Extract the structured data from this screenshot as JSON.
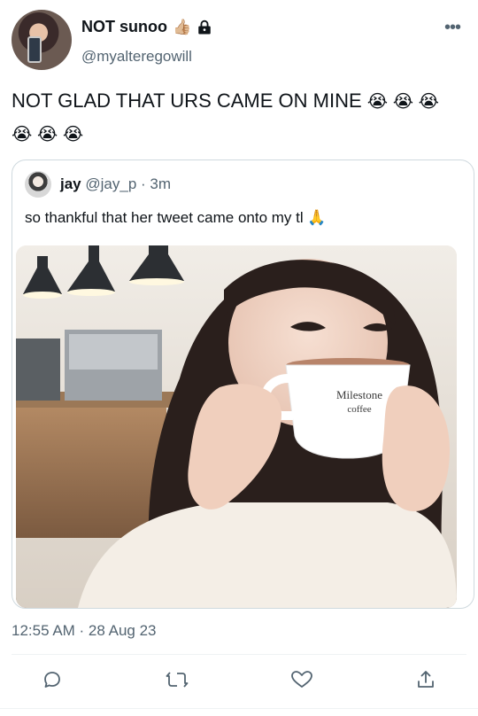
{
  "tweet": {
    "author_name": "NOT sunoo",
    "author_emoji": "👍🏼",
    "handle": "@myalteregowill",
    "text": "NOT GLAD THAT URS CAME ON MINE",
    "text_emojis": "😭 😭 😭",
    "text_emojis_line2": "😭 😭 😭",
    "timestamp": "12:55 AM · 28 Aug 23"
  },
  "quoted": {
    "author_name": "jay",
    "meta": "@jay_p · 3m",
    "text": "so thankful that her tweet came onto my tl",
    "text_emoji": "🙏",
    "photo_cup_text_1": "Milestone",
    "photo_cup_text_2": "coffee"
  },
  "icons": {
    "verified_lock": "lock-icon",
    "more": "more-icon",
    "reply": "reply-icon",
    "retweet": "retweet-icon",
    "like": "like-icon",
    "share": "share-icon"
  },
  "colors": {
    "text_primary": "#0f1419",
    "text_secondary": "#536471",
    "border": "#cfd9de"
  }
}
